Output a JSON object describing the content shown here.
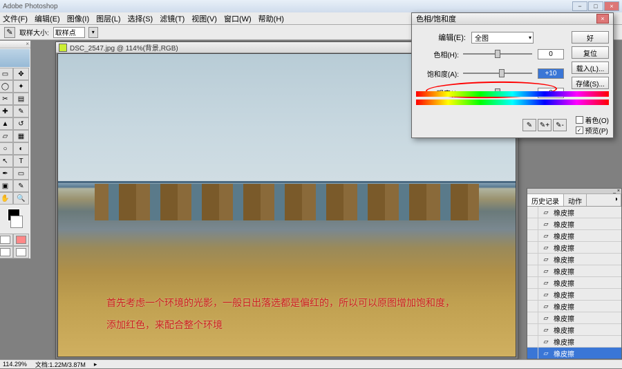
{
  "title": "Adobe Photoshop",
  "menus": [
    "文件(F)",
    "编辑(E)",
    "图像(I)",
    "图层(L)",
    "选择(S)",
    "滤镜(T)",
    "视图(V)",
    "窗口(W)",
    "帮助(H)"
  ],
  "options": {
    "sample_label": "取样大小:",
    "sample_value": "取样点"
  },
  "doc": {
    "title": "DSC_2547.jpg @ 114%(背景,RGB)"
  },
  "annotation": {
    "line1": "首先考虑一个环境的光影，一般日出落选都是偏红的，所以可以原图增加饱和度，",
    "line2": "添加红色，来配合整个环境"
  },
  "dialog": {
    "title": "色相/饱和度",
    "edit_label": "编辑(E):",
    "edit_value": "全图",
    "sliders": [
      {
        "label": "色相(H):",
        "value": "0",
        "pos": 50,
        "sel": false
      },
      {
        "label": "饱和度(A):",
        "value": "+10",
        "pos": 56,
        "sel": true
      },
      {
        "label": "明度(I):",
        "value": "0",
        "pos": 50,
        "sel": false
      }
    ],
    "buttons": [
      "好",
      "复位",
      "载入(L)...",
      "存储(S)..."
    ],
    "colorize": "着色(O)",
    "preview": "预览(P)"
  },
  "history": {
    "tabs": [
      "历史记录",
      "动作"
    ],
    "items": [
      "橡皮擦",
      "橡皮擦",
      "橡皮擦",
      "橡皮擦",
      "橡皮擦",
      "橡皮擦",
      "橡皮擦",
      "橡皮擦",
      "橡皮擦",
      "橡皮擦",
      "橡皮擦",
      "橡皮擦",
      "橡皮擦"
    ]
  },
  "status": {
    "zoom": "114.29%",
    "docinfo": "文档:1.22M/3.87M"
  }
}
